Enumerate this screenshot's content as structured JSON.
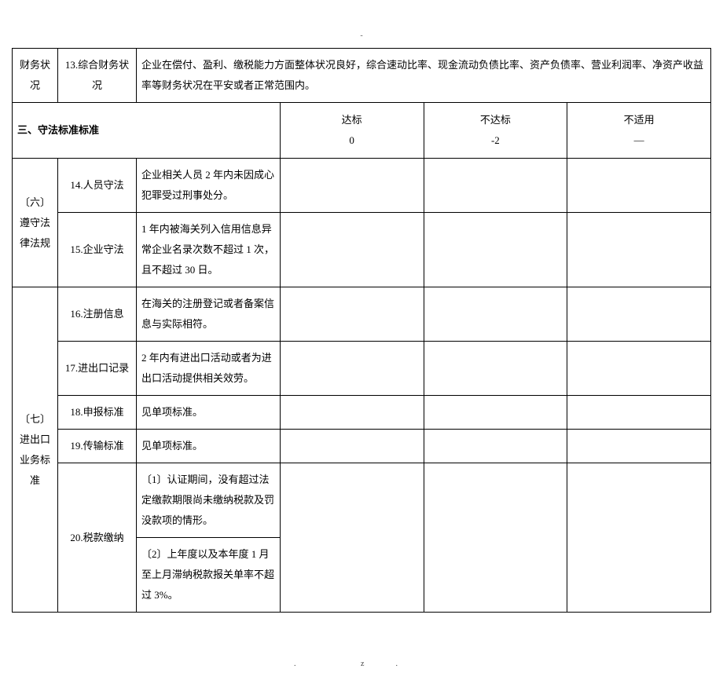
{
  "topDash": "-",
  "row_financial": {
    "cat": "财务状况",
    "item": "13.综合财务状况",
    "desc": "企业在偿付、盈利、缴税能力方面整体状况良好，综合速动比率、现金流动负债比率、资产负债率、营业利润率、净资产收益率等财务状况在平安或者正常范围内。"
  },
  "section3": {
    "title": "三、守法标准标准",
    "colA": "达标",
    "colA2": "0",
    "colB": "不达标",
    "colB2": "-2",
    "colC": "不适用",
    "colC2": "—"
  },
  "cat6": {
    "label": "〔六〕遵守法律法规",
    "r14_item": "14.人员守法",
    "r14_desc": "企业相关人员 2 年内未因成心犯罪受过刑事处分。",
    "r15_item": "15.企业守法",
    "r15_desc": "1 年内被海关列入信用信息异常企业名录次数不超过 1 次，且不超过 30 日。"
  },
  "cat7": {
    "label": "〔七〕进出口业务标准",
    "r16_item": "16.注册信息",
    "r16_desc": "在海关的注册登记或者备案信息与实际相符。",
    "r17_item": "17.进出口记录",
    "r17_desc": "2 年内有进出口活动或者为进出口活动提供相关效劳。",
    "r18_item": "18.申报标准",
    "r18_desc": "见单项标准。",
    "r19_item": "19.传输标准",
    "r19_desc": "见单项标准。",
    "r20_item": "20.税款缴纳",
    "r20_desc1": "〔1〕认证期间，没有超过法定缴款期限尚未缴纳税款及罚没款项的情形。",
    "r20_desc2": "〔2〕上年度以及本年度 1 月至上月滞纳税款报关单率不超过 3%。"
  },
  "footer": ". z."
}
